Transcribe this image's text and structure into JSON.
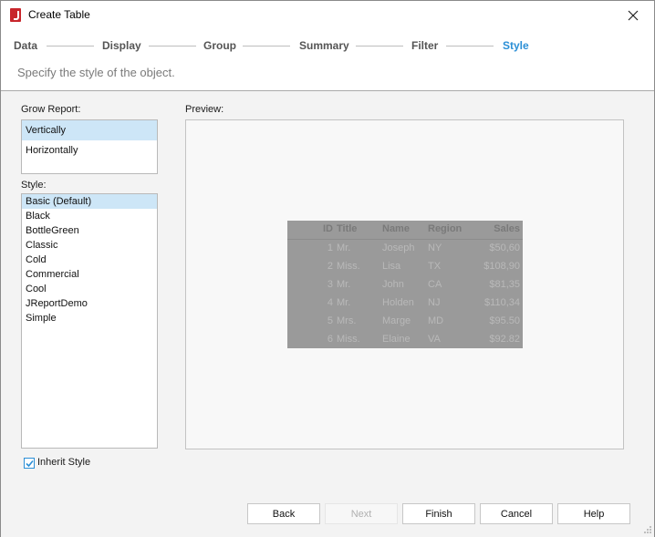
{
  "window": {
    "title": "Create Table"
  },
  "steps": [
    {
      "label": "Data",
      "active": false
    },
    {
      "label": "Display",
      "active": false
    },
    {
      "label": "Group",
      "active": false
    },
    {
      "label": "Summary",
      "active": false
    },
    {
      "label": "Filter",
      "active": false
    },
    {
      "label": "Style",
      "active": true
    }
  ],
  "subtitle": "Specify the style of the object.",
  "grow_report": {
    "label": "Grow Report:",
    "options": [
      "Vertically",
      "Horizontally"
    ],
    "selected": "Vertically"
  },
  "style": {
    "label": "Style:",
    "options": [
      "Basic (Default)",
      "Black",
      "BottleGreen",
      "Classic",
      "Cold",
      "Commercial",
      "Cool",
      "JReportDemo",
      "Simple"
    ],
    "selected": "Basic (Default)"
  },
  "preview": {
    "label": "Preview:",
    "headers": [
      "ID",
      "Title",
      "Name",
      "Region",
      "Sales"
    ],
    "rows": [
      [
        "1",
        "Mr.",
        "Joseph",
        "NY",
        "$50,60"
      ],
      [
        "2",
        "Miss.",
        "Lisa",
        "TX",
        "$108,90"
      ],
      [
        "3",
        "Mr.",
        "John",
        "CA",
        "$81,35"
      ],
      [
        "4",
        "Mr.",
        "Holden",
        "NJ",
        "$110,34"
      ],
      [
        "5",
        "Mrs.",
        "Marge",
        "MD",
        "$95.50"
      ],
      [
        "6",
        "Miss.",
        "Elaine",
        "VA",
        "$92.82"
      ]
    ]
  },
  "inherit_style": {
    "label": "Inherit Style",
    "checked": true
  },
  "buttons": {
    "back": "Back",
    "next": "Next",
    "finish": "Finish",
    "cancel": "Cancel",
    "help": "Help"
  },
  "colors": {
    "accent": "#2b8fd6",
    "selection": "#cde6f7",
    "preview_table_bg": "#9a9a9a"
  }
}
